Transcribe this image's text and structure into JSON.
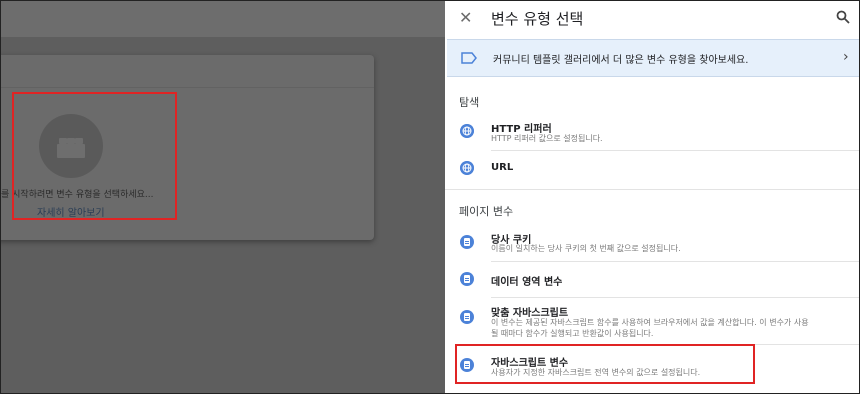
{
  "background": {
    "card_text": "를 시작하려면 변수 유형을 선택하세요...",
    "card_link": "자세히 알아보기"
  },
  "panel": {
    "title": "변수 유형 선택",
    "banner_text": "커뮤니티 템플릿 갤러리에서 더 많은 변수 유형을 찾아보세요.",
    "sections": [
      {
        "title": "탐색",
        "items": [
          {
            "title": "HTTP 리퍼러",
            "subtitle": "HTTP 리퍼러 값으로 설정됩니다."
          },
          {
            "title": "URL",
            "subtitle": ""
          }
        ]
      },
      {
        "title": "페이지 변수",
        "items": [
          {
            "title": "당사 쿠키",
            "subtitle": "이름이 일치하는 당사 쿠키의 첫 번째 값으로 설정됩니다."
          },
          {
            "title": "데이터 영역 변수",
            "subtitle": ""
          },
          {
            "title": "맞춤 자바스크립트",
            "subtitle": "이 변수는 제공된 자바스크립트 함수를 사용하여 브라우저에서 값을 계산합니다. 이 변수가 사용",
            "subtitle2": "될 때마다 함수가 실행되고 반환값이 사용됩니다."
          },
          {
            "title": "자바스크립트 변수",
            "subtitle": "사용자가 지정한 자바스크립트 전역 변수의 값으로 설정됩니다."
          }
        ]
      }
    ]
  },
  "icons": {
    "close": "close-icon",
    "search": "search-icon",
    "banner": "tag-icon",
    "chevron": "chevron-right-icon",
    "globe": "globe-icon",
    "document": "document-icon",
    "placeholder": "brick-icon"
  },
  "colors": {
    "accent": "#4c82d8",
    "highlight_box": "#e02424",
    "banner_bg": "#e6f0fb"
  }
}
